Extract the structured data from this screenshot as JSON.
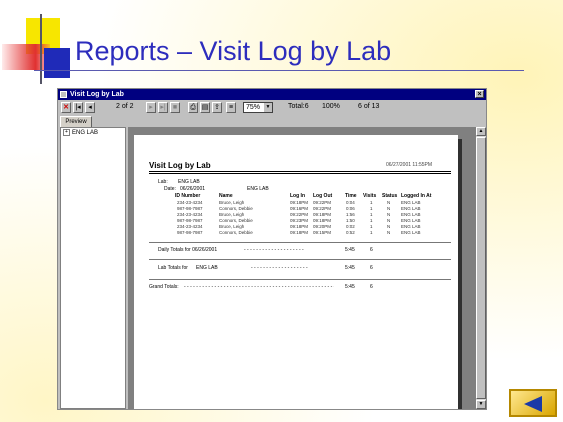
{
  "slide": {
    "title": "Reports – Visit Log by Lab"
  },
  "window": {
    "title": "Visit Log by Lab",
    "close_glyph": "×",
    "toolbar": {
      "page_indicator": "2 of 2",
      "zoom": "75%",
      "total": "Total:6",
      "percent": "100%",
      "record_count": "6 of 13"
    },
    "tab_preview": "Preview",
    "tree": {
      "expander": "+",
      "item": "ENG LAB"
    }
  },
  "report": {
    "title": "Visit Log by Lab",
    "printed_at": "06/27/2001 11:55PM",
    "lab_label": "Lab:",
    "lab_value": "ENG LAB",
    "date_label": "Date:",
    "date_value": "06/26/2001",
    "date_lab": "ENG LAB",
    "columns": [
      "ID Number",
      "Name",
      "Log In",
      "Log Out",
      "Time",
      "Visits",
      "Status",
      "Logged In At"
    ],
    "rows": [
      [
        "234-23-4234",
        "Bruce, Leigh",
        "09:18PM",
        "09:22PM",
        "0:04",
        "1",
        "N",
        "ENG LAB"
      ],
      [
        "987-98-7987",
        "Connors, Debbie",
        "09:16PM",
        "09:22PM",
        "0:06",
        "1",
        "N",
        "ENG LAB"
      ],
      [
        "234-23-4234",
        "Bruce, Leigh",
        "09:22PM",
        "09:18PM",
        "1:56",
        "1",
        "N",
        "ENG LAB"
      ],
      [
        "987-98-7987",
        "Connors, Debbie",
        "09:23PM",
        "09:18PM",
        "1:50",
        "1",
        "N",
        "ENG LAB"
      ],
      [
        "234-23-4234",
        "Bruce, Leigh",
        "09:18PM",
        "09:20PM",
        "0:02",
        "1",
        "N",
        "ENG LAB"
      ],
      [
        "987-98-7987",
        "Connors, Debbie",
        "09:18PM",
        "09:15PM",
        "0:52",
        "1",
        "N",
        "ENG LAB"
      ]
    ],
    "daily_totals_label": "Daily Totals for 06/26/2001",
    "daily_dots": "- - - - - - - - - - - - - - - - - - - -",
    "daily_time": "5:45",
    "daily_visits": "6",
    "lab_totals_label": "Lab Totals for",
    "lab_totals_lab": "ENG LAB",
    "lab_dots": "- - - - - - - - - - - - - - - - - - -",
    "lab_time": "5:45",
    "lab_visits": "6",
    "grand_totals_label": "Grand Totals:",
    "grand_dots": "- - - - - - - - - - - - - - - - - - - - - - - - - - - - - - - - - - - - - - - - - - - - - - - - - - -",
    "grand_time": "5:45",
    "grand_visits": "6"
  }
}
